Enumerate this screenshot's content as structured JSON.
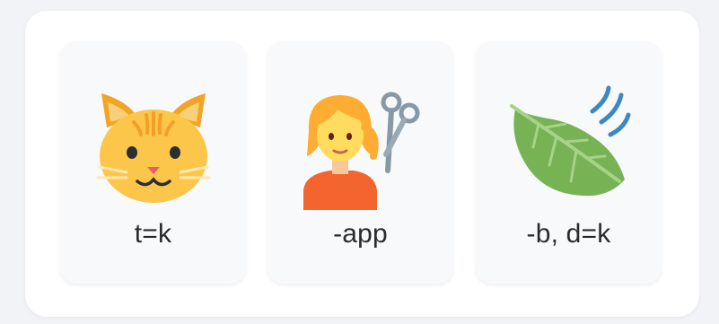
{
  "cards": [
    {
      "label": "t=k",
      "icon": "cat-face-icon"
    },
    {
      "label": "-app",
      "icon": "haircut-person-icon"
    },
    {
      "label": "-b, d=k",
      "icon": "leaf-in-wind-icon"
    }
  ],
  "colors": {
    "background": "#f1f3f7",
    "panel": "#ffffff",
    "card": "#f8f9fb",
    "text": "#2b2b2b",
    "cat": "#fcc64a",
    "leaf": "#77b255",
    "wind": "#3b88c3"
  }
}
